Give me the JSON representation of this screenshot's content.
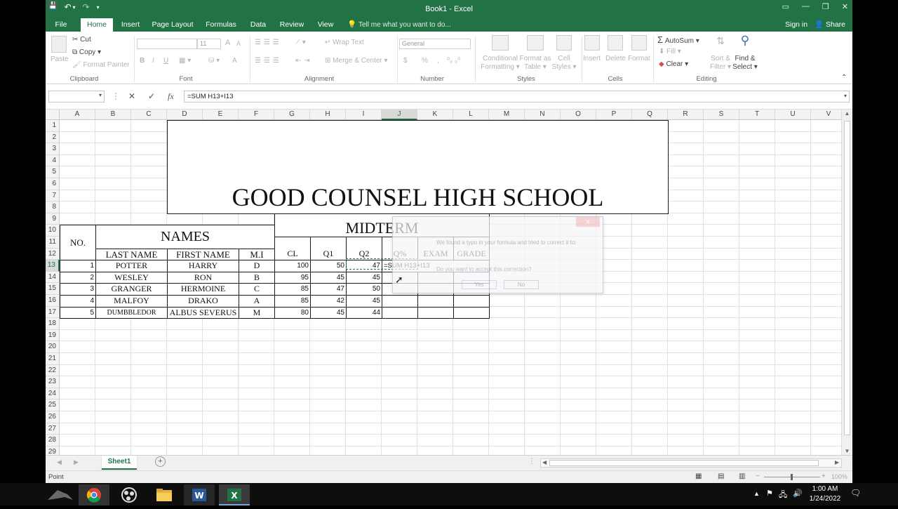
{
  "window": {
    "title": "Book1 - Excel",
    "controls": [
      "▭",
      "—",
      "❐",
      "✕"
    ]
  },
  "qat": {
    "save": "💾",
    "undo": "↶",
    "redo": "↷",
    "more": "▾"
  },
  "tabs": [
    {
      "label": "File",
      "active": false
    },
    {
      "label": "Home",
      "active": true
    },
    {
      "label": "Insert",
      "active": false
    },
    {
      "label": "Page Layout",
      "active": false
    },
    {
      "label": "Formulas",
      "active": false
    },
    {
      "label": "Data",
      "active": false
    },
    {
      "label": "Review",
      "active": false
    },
    {
      "label": "View",
      "active": false
    }
  ],
  "tell_me": "Tell me what you want to do...",
  "sign_in": "Sign in",
  "share": "Share",
  "ribbon": {
    "clipboard": {
      "paste": "Paste",
      "cut": "Cut",
      "copy": "Copy",
      "format_painter": "Format Painter",
      "group": "Clipboard"
    },
    "font": {
      "name": "",
      "size": "11",
      "grow": "A",
      "shrink": "A",
      "bold": "B",
      "italic": "I",
      "underline": "U",
      "font_color": "A",
      "group": "Font"
    },
    "alignment": {
      "wrap": "Wrap Text",
      "merge": "Merge & Center",
      "group": "Alignment"
    },
    "number": {
      "format": "General",
      "currency": "$",
      "percent": "%",
      "comma": ",",
      "group": "Number"
    },
    "styles": {
      "conditional": "Conditional",
      "conditional2": "Formatting",
      "format_as": "Format as",
      "format_as2": "Table",
      "cell": "Cell",
      "cell2": "Styles",
      "group": "Styles"
    },
    "cells": {
      "insert": "Insert",
      "delete": "Delete",
      "format": "Format",
      "group": "Cells"
    },
    "editing": {
      "autosum": "AutoSum",
      "fill": "Fill",
      "clear": "Clear",
      "sort": "Sort &",
      "sort2": "Filter",
      "find": "Find &",
      "find2": "Select",
      "group": "Editing"
    }
  },
  "formula_bar": {
    "name_box": "",
    "cancel": "✕",
    "enter": "✓",
    "fx": "fx",
    "formula": "=SUM H13+I13"
  },
  "columns": [
    "A",
    "B",
    "C",
    "D",
    "E",
    "F",
    "G",
    "H",
    "I",
    "J",
    "K",
    "L",
    "M",
    "N",
    "O",
    "P",
    "Q",
    "R",
    "S",
    "T",
    "U",
    "V"
  ],
  "rows": [
    "1",
    "2",
    "3",
    "4",
    "5",
    "6",
    "7",
    "8",
    "9",
    "10",
    "11",
    "12",
    "13",
    "14",
    "15",
    "16",
    "17",
    "18",
    "19",
    "20",
    "21",
    "22",
    "23",
    "24",
    "25",
    "26",
    "27",
    "28",
    "29"
  ],
  "sheet": {
    "title": "GOOD COUNSEL HIGH SCHOOL",
    "midterm": "MIDTERM",
    "no_header": "NO.",
    "names_header": "NAMES",
    "last_name": "LAST NAME",
    "first_name": "FIRST NAME",
    "mi": "M.I",
    "cl": "CL",
    "q1": "Q1",
    "q2": "Q2",
    "qpct": "Q%",
    "exam": "EXAM",
    "grade": "GRADE",
    "students": [
      {
        "no": "1",
        "last": "POTTER",
        "first": "HARRY",
        "mi": "D",
        "cl": "100",
        "q1": "50",
        "q2": "47"
      },
      {
        "no": "2",
        "last": "WESLEY",
        "first": "RON",
        "mi": "B",
        "cl": "95",
        "q1": "45",
        "q2": "45"
      },
      {
        "no": "3",
        "last": "GRANGER",
        "first": "HERMOINE",
        "mi": "C",
        "cl": "85",
        "q1": "47",
        "q2": "50"
      },
      {
        "no": "4",
        "last": "MALFOY",
        "first": "DRAKO",
        "mi": "A",
        "cl": "85",
        "q1": "42",
        "q2": "45"
      },
      {
        "no": "5",
        "last": "DUMBBLEDOR",
        "first": "ALBUS SEVERUS",
        "mi": "M",
        "cl": "80",
        "q1": "45",
        "q2": "44"
      }
    ],
    "editing_formula": "=SUM H13+I13"
  },
  "dialog": {
    "message": "We found a typo in your formula and tried to correct it to:",
    "question": "Do you want to accept this correction?",
    "yes": "Yes",
    "no": "No",
    "close": "✕"
  },
  "sheet_tabs": {
    "active": "Sheet1",
    "add": "+"
  },
  "status": {
    "mode": "Point",
    "zoom": "100%"
  },
  "taskbar": {
    "time": "1:00 AM",
    "date": "1/24/2022",
    "apps": [
      "rog-logo",
      "chrome-icon",
      "obs-icon",
      "file-explorer-icon",
      "word-icon",
      "excel-icon"
    ]
  },
  "colors": {
    "excel_green": "#217346",
    "taskbar": "#0e0e0e"
  }
}
